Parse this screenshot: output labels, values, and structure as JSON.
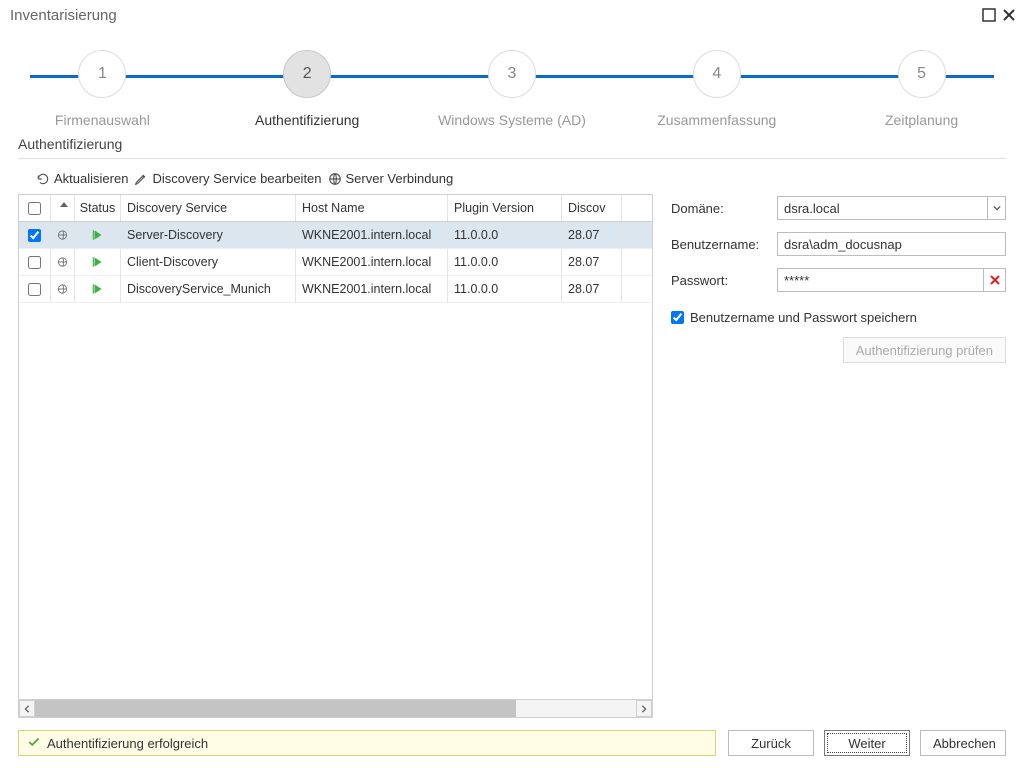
{
  "window": {
    "title": "Inventarisierung"
  },
  "stepper": {
    "steps": [
      {
        "num": "1",
        "label": "Firmenauswahl"
      },
      {
        "num": "2",
        "label": "Authentifizierung"
      },
      {
        "num": "3",
        "label": "Windows Systeme (AD)"
      },
      {
        "num": "4",
        "label": "Zusammenfassung"
      },
      {
        "num": "5",
        "label": "Zeitplanung"
      }
    ],
    "active_index": 1
  },
  "section_title": "Authentifizierung",
  "toolbar": {
    "refresh": "Aktualisieren",
    "edit": "Discovery Service bearbeiten",
    "server": "Server Verbindung"
  },
  "grid": {
    "headers": {
      "status": "Status",
      "ds": "Discovery Service",
      "host": "Host Name",
      "plugin": "Plugin Version",
      "discov": "Discov"
    },
    "rows": [
      {
        "checked": true,
        "ds": "Server-Discovery",
        "host": "WKNE2001.intern.local",
        "plugin": "11.0.0.0",
        "discov": "28.07"
      },
      {
        "checked": false,
        "ds": "Client-Discovery",
        "host": "WKNE2001.intern.local",
        "plugin": "11.0.0.0",
        "discov": "28.07"
      },
      {
        "checked": false,
        "ds": "DiscoveryService_Munich",
        "host": "WKNE2001.intern.local",
        "plugin": "11.0.0.0",
        "discov": "28.07"
      }
    ],
    "selected_row": 0
  },
  "form": {
    "domain_label": "Domäne:",
    "domain_value": "dsra.local",
    "user_label": "Benutzername:",
    "user_value": "dsra\\adm_docusnap",
    "pass_label": "Passwort:",
    "pass_value": "*****",
    "save_creds_label": "Benutzername und Passwort speichern",
    "auth_check_btn": "Authentifizierung prüfen"
  },
  "status": {
    "message": "Authentifizierung erfolgreich"
  },
  "footer": {
    "back": "Zurück",
    "next": "Weiter",
    "cancel": "Abbrechen"
  }
}
